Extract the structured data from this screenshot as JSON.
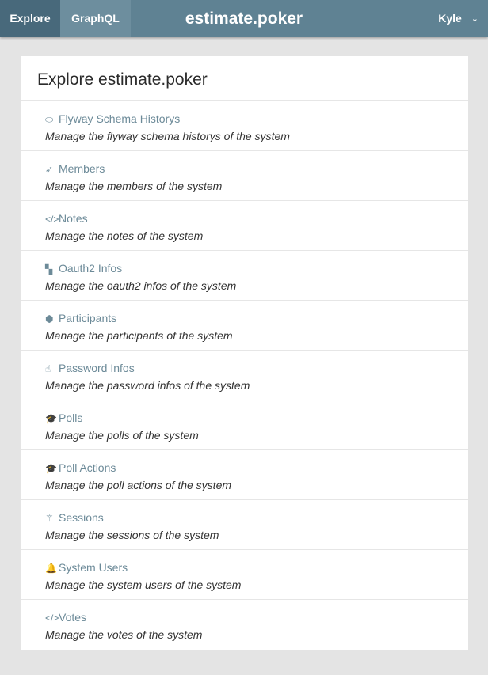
{
  "nav": {
    "tabs": [
      {
        "label": "Explore"
      },
      {
        "label": "GraphQL"
      }
    ],
    "brand": "estimate.poker",
    "user": "Kyle",
    "user_icon": "chevron-down-icon"
  },
  "main": {
    "title": "Explore estimate.poker",
    "items": [
      {
        "label": "Flyway Schema Historys",
        "description": "Manage the flyway schema historys of the system",
        "icon": "lemon-icon",
        "glyph": "⬭"
      },
      {
        "label": "Members",
        "description": "Manage the members of the system",
        "icon": "paper-plane-icon",
        "glyph": "➶"
      },
      {
        "label": "Notes",
        "description": "Manage the notes of the system",
        "icon": "code-icon",
        "glyph": "</>"
      },
      {
        "label": "Oauth2 Infos",
        "description": "Manage the oauth2 infos of the system",
        "icon": "scroll-icon",
        "glyph": "▚"
      },
      {
        "label": "Participants",
        "description": "Manage the participants of the system",
        "icon": "cube-icon",
        "glyph": "⬢"
      },
      {
        "label": "Password Infos",
        "description": "Manage the password infos of the system",
        "icon": "hand-pointer-icon",
        "glyph": "☝"
      },
      {
        "label": "Polls",
        "description": "Manage the polls of the system",
        "icon": "graduation-cap-icon",
        "glyph": "🎓"
      },
      {
        "label": "Poll Actions",
        "description": "Manage the poll actions of the system",
        "icon": "graduation-cap-icon",
        "glyph": "🎓"
      },
      {
        "label": "Sessions",
        "description": "Manage the sessions of the system",
        "icon": "magic-wand-icon",
        "glyph": "⚚"
      },
      {
        "label": "System Users",
        "description": "Manage the system users of the system",
        "icon": "bell-icon",
        "glyph": "🔔"
      },
      {
        "label": "Votes",
        "description": "Manage the votes of the system",
        "icon": "code-icon",
        "glyph": "</>"
      }
    ]
  },
  "colors": {
    "topbar": "#5f8293",
    "active_tab": "#48697b",
    "link": "#6c8a98",
    "background": "#e4e4e4"
  }
}
